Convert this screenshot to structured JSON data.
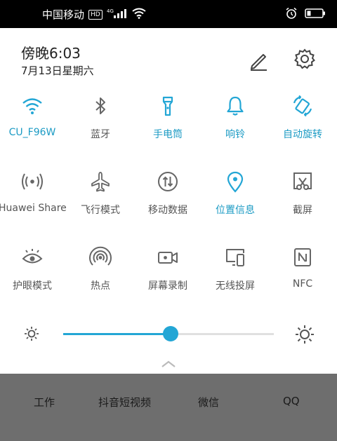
{
  "status_bar": {
    "carrier": "中国移动",
    "hd": "HD",
    "network": "4G"
  },
  "panel": {
    "time": "傍晚6:03",
    "date": "7月13日星期六",
    "tiles": [
      {
        "label": "CU_F96W"
      },
      {
        "label": "蓝牙"
      },
      {
        "label": "手电筒"
      },
      {
        "label": "响铃"
      },
      {
        "label": "自动旋转"
      },
      {
        "label": "Huawei Share"
      },
      {
        "label": "飞行模式"
      },
      {
        "label": "移动数据"
      },
      {
        "label": "位置信息"
      },
      {
        "label": "截屏"
      },
      {
        "label": "护眼模式"
      },
      {
        "label": "热点"
      },
      {
        "label": "屏幕录制"
      },
      {
        "label": "无线投屏"
      },
      {
        "label": "NFC"
      }
    ],
    "brightness_level": 0.51
  },
  "dock": {
    "apps": [
      "工作",
      "抖音短视频",
      "微信",
      "QQ"
    ]
  },
  "colors": {
    "accent": "#23a6d5",
    "text": "#555555"
  }
}
